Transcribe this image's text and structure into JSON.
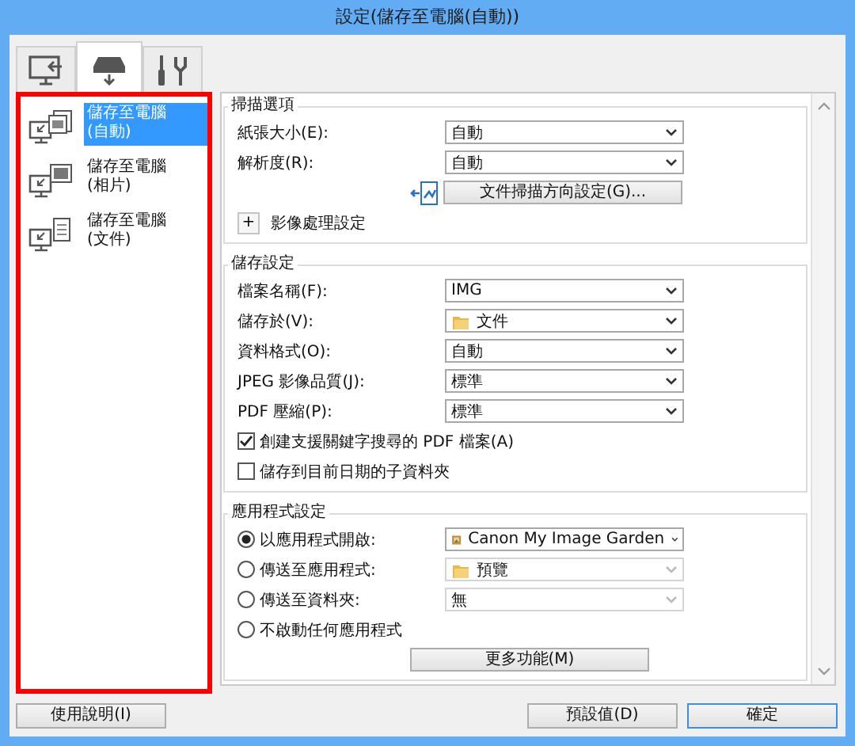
{
  "window": {
    "title": "設定(儲存至電腦(自動))"
  },
  "tabs": [
    {
      "selected": false
    },
    {
      "selected": true
    },
    {
      "selected": false
    }
  ],
  "sidebar": {
    "items": [
      {
        "label": "儲存至電腦\n(自動)",
        "selected": true
      },
      {
        "label": "儲存至電腦\n(相片)",
        "selected": false
      },
      {
        "label": "儲存至電腦\n(文件)",
        "selected": false
      }
    ]
  },
  "sections": [
    {
      "title": "掃描選項",
      "rows": [
        {
          "kind": "select",
          "label": "紙張大小(E):",
          "value": "自動",
          "disabled": false
        },
        {
          "kind": "select",
          "label": "解析度(R):",
          "value": "自動",
          "disabled": false
        },
        {
          "kind": "button",
          "label": "文件掃描方向設定(G)..."
        },
        {
          "kind": "expander",
          "symbol": "+",
          "label": "影像處理設定"
        }
      ]
    },
    {
      "title": "儲存設定",
      "rows": [
        {
          "kind": "select",
          "label": "檔案名稱(F):",
          "value": "IMG",
          "disabled": false
        },
        {
          "kind": "select",
          "label": "儲存於(V):",
          "value": "文件",
          "disabled": false
        },
        {
          "kind": "select",
          "label": "資料格式(O):",
          "value": "自動",
          "disabled": false
        },
        {
          "kind": "select",
          "label": "JPEG 影像品質(J):",
          "value": "標準",
          "disabled": false
        },
        {
          "kind": "select",
          "label": "PDF 壓縮(P):",
          "value": "標準",
          "disabled": false
        },
        {
          "kind": "checkbox",
          "label": "創建支援關鍵字搜尋的 PDF 檔案(A)",
          "checked": true
        },
        {
          "kind": "checkbox",
          "label": "儲存到目前日期的子資料夾",
          "checked": false
        }
      ]
    },
    {
      "title": "應用程式設定",
      "rows": [
        {
          "kind": "radio",
          "label": "以應用程式開啟:",
          "selected": true,
          "value": "Canon My Image Garden",
          "disabled": false
        },
        {
          "kind": "radio",
          "label": "傳送至應用程式:",
          "selected": false,
          "value": "預覽",
          "disabled": true
        },
        {
          "kind": "radio",
          "label": "傳送至資料夾:",
          "selected": false,
          "value": "無",
          "disabled": true
        },
        {
          "kind": "radio",
          "label": "不啟動任何應用程式",
          "selected": false
        },
        {
          "kind": "button",
          "label": "更多功能(M)"
        }
      ]
    }
  ],
  "footer": {
    "buttons": [
      {
        "label": "使用說明(I)",
        "default": false
      },
      {
        "label": "預設值(D)",
        "default": false
      },
      {
        "label": "確定",
        "default": true
      }
    ]
  }
}
